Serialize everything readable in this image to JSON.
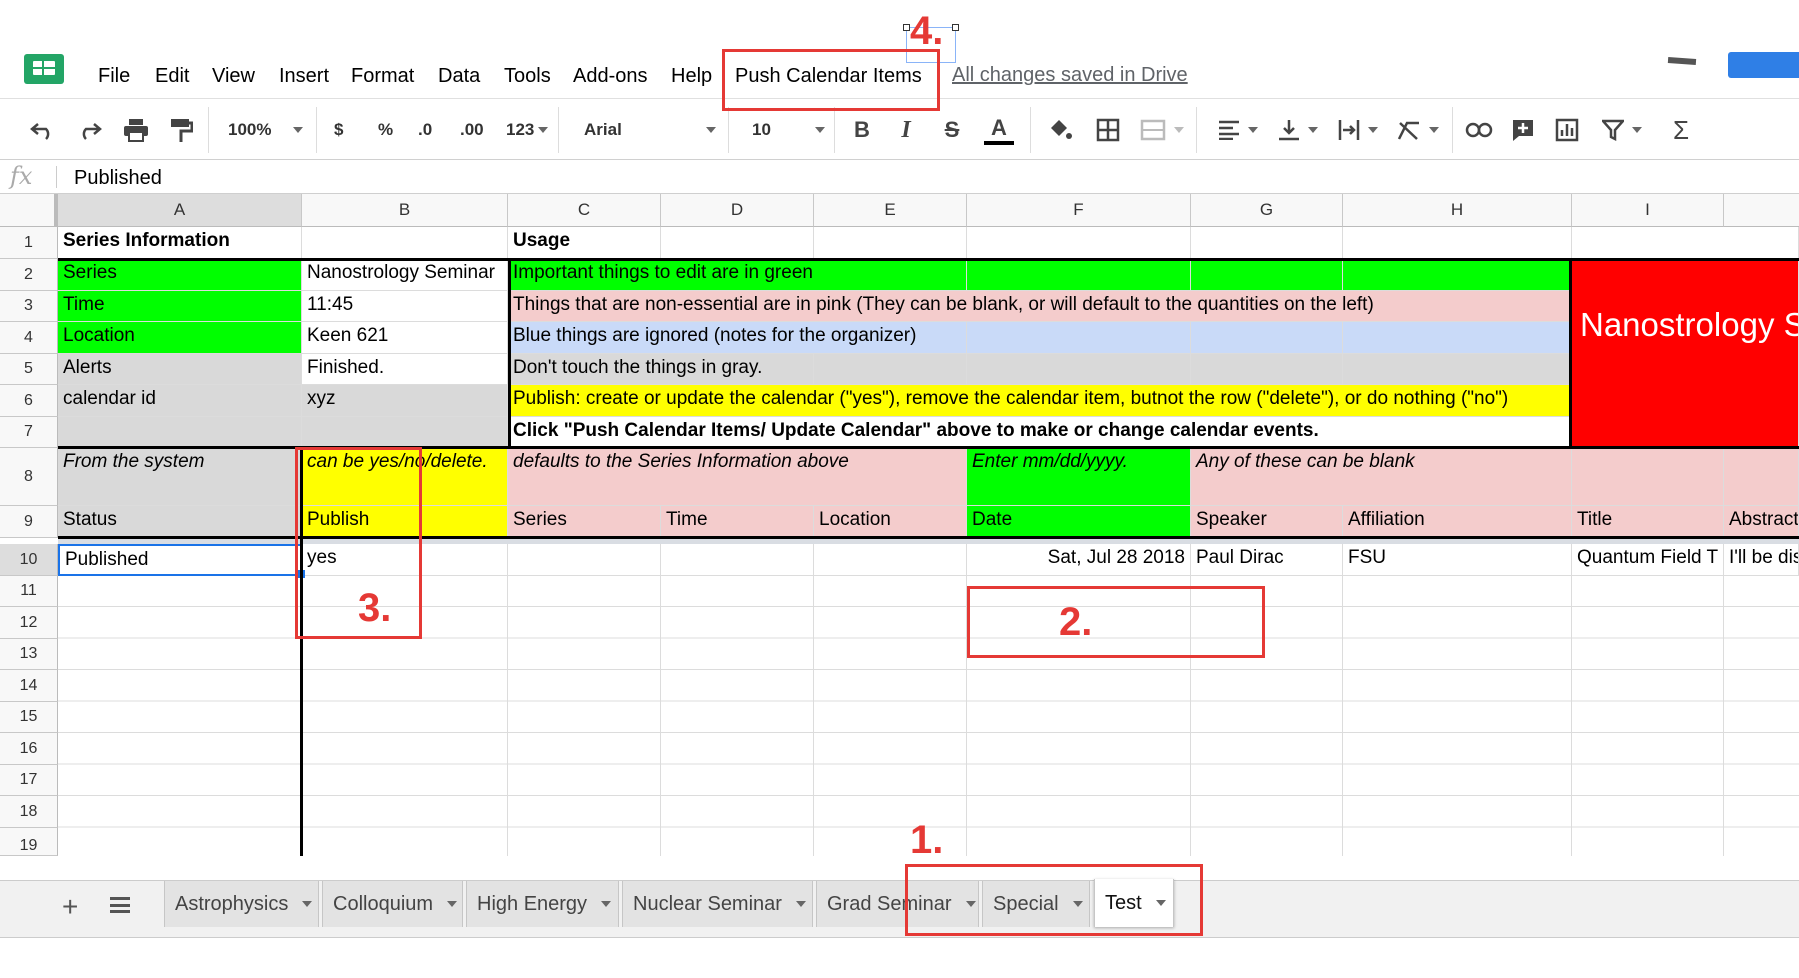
{
  "menubar": {
    "items": [
      "File",
      "Edit",
      "View",
      "Insert",
      "Format",
      "Data",
      "Tools",
      "Add-ons",
      "Help",
      "Push Calendar Items"
    ],
    "save_status": "All changes saved in Drive"
  },
  "toolbar": {
    "zoom": "100%",
    "currency": "$",
    "percent": "%",
    "dec_decrease": ".0",
    "dec_increase": ".00",
    "more_formats": "123",
    "font": "Arial",
    "font_size": "10"
  },
  "formula_bar": {
    "label": "fx",
    "value": "Published"
  },
  "columns": [
    "A",
    "B",
    "C",
    "D",
    "E",
    "F",
    "G",
    "H",
    "I"
  ],
  "rows": [
    "1",
    "2",
    "3",
    "4",
    "5",
    "6",
    "7",
    "8",
    "9",
    "10",
    "11",
    "12",
    "13",
    "14",
    "15",
    "16",
    "17",
    "18",
    "19"
  ],
  "cells": {
    "a1": "Series Information",
    "c1": "Usage",
    "a2": "Series",
    "b2": "Nanostrology Seminar",
    "a3": "Time",
    "b3": "11:45",
    "a4": "Location",
    "b4": "Keen 621",
    "a5": "Alerts",
    "b5": "Finished.",
    "a6": "calendar id",
    "b6": "xyz",
    "c2": "Important things to edit are in green",
    "c3": "Things that are non-essential are in pink (They can be blank, or will default to the quantities on the left)",
    "c4": "Blue things are ignored (notes for the organizer)",
    "c5": "Don't touch the things in gray.",
    "c6": "Publish: create or update the calendar (\"yes\"), remove the calendar item, butnot the row (\"delete\"), or do nothing (\"no\")",
    "c7": "Click \"Push Calendar Items/ Update Calendar\" above to make or change calendar events.",
    "i2": "Nanostrology S",
    "a8": "From the system",
    "b8": "can be yes/no/delete.",
    "c8": "defaults to the Series Information above",
    "f8": "Enter mm/dd/yyyy.",
    "g8": "Any of these can be blank",
    "a9": "Status",
    "b9": "Publish",
    "c9": "Series",
    "d9": "Time",
    "e9": "Location",
    "f9": "Date",
    "g9": "Speaker",
    "h9": "Affiliation",
    "i9": "Title",
    "j9": "Abstract",
    "a10": "Published",
    "b10": "yes",
    "f10": "Sat, Jul 28 2018",
    "g10": "Paul Dirac",
    "h10": "FSU",
    "i10": "Quantum Field T",
    "j10": "I'll be dis"
  },
  "sheet_tabs": [
    "Astrophysics",
    "Colloquium",
    "High Energy",
    "Nuclear Seminar",
    "Grad Seminar",
    "Special",
    "Test"
  ],
  "active_tab": "Test",
  "annotations": [
    "1.",
    "2.",
    "3.",
    "4."
  ],
  "colors": {
    "green": "#00ff00",
    "pink": "#f4cccc",
    "blue": "#c9daf8",
    "gray": "#d9d9d9",
    "yellow": "#ffff00",
    "red": "#ff0000",
    "annotation": "#e53935"
  }
}
